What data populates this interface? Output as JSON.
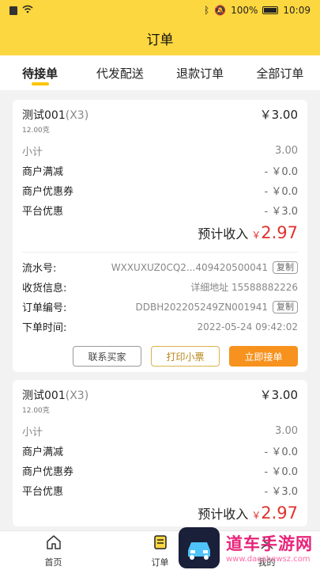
{
  "statusbar": {
    "battery": "100%",
    "time": "10:09"
  },
  "header": {
    "title": "订单"
  },
  "tabs": [
    {
      "label": "待接单",
      "active": true
    },
    {
      "label": "代发配送",
      "active": false
    },
    {
      "label": "退款订单",
      "active": false
    },
    {
      "label": "全部订单",
      "active": false
    }
  ],
  "orders": [
    {
      "product_name": "测试001",
      "product_qty": "(X3)",
      "product_price": "￥3.00",
      "product_weight": "12.00克",
      "fees": [
        {
          "label": "小计",
          "value": "3.00"
        },
        {
          "label": "商户满减",
          "value": "- ￥0.0"
        },
        {
          "label": "商户优惠券",
          "value": "- ￥0.0"
        },
        {
          "label": "平台优惠",
          "value": "- ￥3.0"
        }
      ],
      "income_label": "预计收入",
      "income_currency": "￥",
      "income_amount": "2.97",
      "serial_label": "流水号:",
      "serial_value": "WXXUXUZ0CQ2...409420500041",
      "copy_label": "复制",
      "shipping_label": "收货信息:",
      "shipping_value": "详细地址 15588882226",
      "order_no_label": "订单编号:",
      "order_no_value": "DDBH202205249ZN001941",
      "time_label": "下单时间:",
      "time_value": "2022-05-24 09:42:02",
      "buttons": {
        "contact": "联系买家",
        "print": "打印小票",
        "accept": "立即接单"
      }
    },
    {
      "product_name": "测试001",
      "product_qty": "(X3)",
      "product_price": "￥3.00",
      "product_weight": "12.00克",
      "fees": [
        {
          "label": "小计",
          "value": "3.00"
        },
        {
          "label": "商户满减",
          "value": "- ￥0.0"
        },
        {
          "label": "商户优惠券",
          "value": "- ￥0.0"
        },
        {
          "label": "平台优惠",
          "value": "- ￥3.0"
        }
      ],
      "income_label": "预计收入",
      "income_currency": "￥",
      "income_amount": "2.97"
    }
  ],
  "bottom_nav": [
    {
      "label": "首页",
      "icon": "home-icon"
    },
    {
      "label": "订单",
      "icon": "order-icon"
    },
    {
      "label": "我的",
      "icon": "profile-icon"
    }
  ],
  "watermark": {
    "title": "道车手游网",
    "url": "www.daochewsz.com"
  },
  "colors": {
    "brand_yellow": "#fdd73f",
    "accent_orange": "#f7921e",
    "price_red": "#e0312d"
  }
}
